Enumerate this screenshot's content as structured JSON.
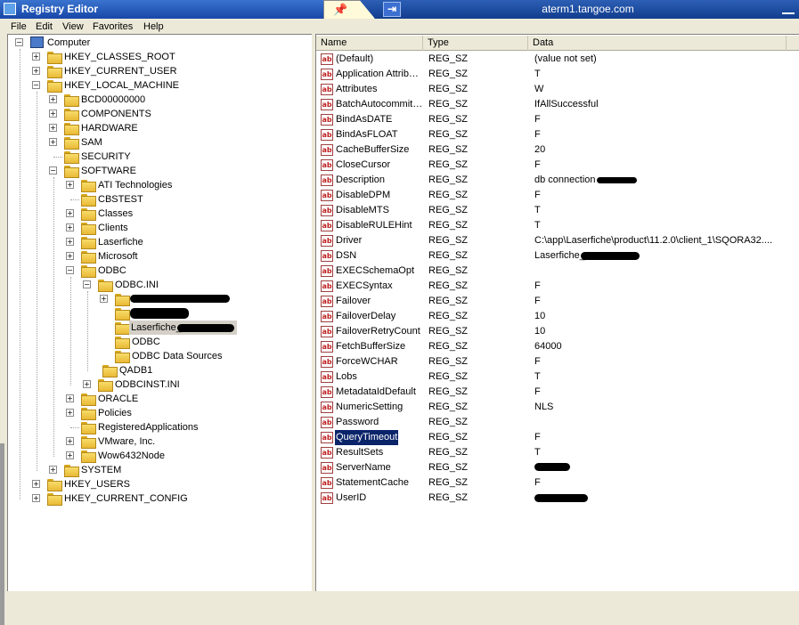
{
  "window": {
    "title": "Registry Editor",
    "remote_host": "aterm1.tangoe.com",
    "pin_glyph": "📌",
    "restore_glyph": "⇥"
  },
  "menu": [
    "File",
    "Edit",
    "View",
    "Favorites",
    "Help"
  ],
  "tree": {
    "computer": "Computer",
    "hkcr": "HKEY_CLASSES_ROOT",
    "hkcu": "HKEY_CURRENT_USER",
    "hklm": "HKEY_LOCAL_MACHINE",
    "bcd": "BCD00000000",
    "components": "COMPONENTS",
    "hardware": "HARDWARE",
    "sam": "SAM",
    "security": "SECURITY",
    "software": "SOFTWARE",
    "ati": "ATI Technologies",
    "cbstest": "CBSTEST",
    "classes": "Classes",
    "clients": "Clients",
    "laserfiche": "Laserfiche",
    "microsoft": "Microsoft",
    "odbc": "ODBC",
    "odbcini": "ODBC.INI",
    "laserfiche_dsn": "Laserfiche_",
    "odbc_sub": "ODBC",
    "odbc_data_sources": "ODBC Data Sources",
    "qadb1": "QADB1",
    "odbcinst": "ODBCINST.INI",
    "oracle": "ORACLE",
    "policies": "Policies",
    "registered_apps": "RegisteredApplications",
    "vmware": "VMware, Inc.",
    "wow6432": "Wow6432Node",
    "system": "SYSTEM",
    "hku": "HKEY_USERS",
    "hkcc": "HKEY_CURRENT_CONFIG"
  },
  "list": {
    "columns": {
      "name": "Name",
      "type": "Type",
      "data": "Data"
    },
    "icon_text": "ab",
    "rows": [
      {
        "name": "(Default)",
        "type": "REG_SZ",
        "data": "(value not set)"
      },
      {
        "name": "Application Attrib…",
        "type": "REG_SZ",
        "data": "T"
      },
      {
        "name": "Attributes",
        "type": "REG_SZ",
        "data": "W"
      },
      {
        "name": "BatchAutocommit…",
        "type": "REG_SZ",
        "data": "IfAllSuccessful"
      },
      {
        "name": "BindAsDATE",
        "type": "REG_SZ",
        "data": "F"
      },
      {
        "name": "BindAsFLOAT",
        "type": "REG_SZ",
        "data": "F"
      },
      {
        "name": "CacheBufferSize",
        "type": "REG_SZ",
        "data": "20"
      },
      {
        "name": "CloseCursor",
        "type": "REG_SZ",
        "data": "F"
      },
      {
        "name": "Description",
        "type": "REG_SZ",
        "data": "db connection"
      },
      {
        "name": "DisableDPM",
        "type": "REG_SZ",
        "data": "F"
      },
      {
        "name": "DisableMTS",
        "type": "REG_SZ",
        "data": "T"
      },
      {
        "name": "DisableRULEHint",
        "type": "REG_SZ",
        "data": "T"
      },
      {
        "name": "Driver",
        "type": "REG_SZ",
        "data": "C:\\app\\Laserfiche\\product\\11.2.0\\client_1\\SQORA32...."
      },
      {
        "name": "DSN",
        "type": "REG_SZ",
        "data": "Laserfiche_"
      },
      {
        "name": "EXECSchemaOpt",
        "type": "REG_SZ",
        "data": ""
      },
      {
        "name": "EXECSyntax",
        "type": "REG_SZ",
        "data": "F"
      },
      {
        "name": "Failover",
        "type": "REG_SZ",
        "data": "F"
      },
      {
        "name": "FailoverDelay",
        "type": "REG_SZ",
        "data": "10"
      },
      {
        "name": "FailoverRetryCount",
        "type": "REG_SZ",
        "data": "10"
      },
      {
        "name": "FetchBufferSize",
        "type": "REG_SZ",
        "data": "64000"
      },
      {
        "name": "ForceWCHAR",
        "type": "REG_SZ",
        "data": "F"
      },
      {
        "name": "Lobs",
        "type": "REG_SZ",
        "data": "T"
      },
      {
        "name": "MetadataIdDefault",
        "type": "REG_SZ",
        "data": "F"
      },
      {
        "name": "NumericSetting",
        "type": "REG_SZ",
        "data": "NLS"
      },
      {
        "name": "Password",
        "type": "REG_SZ",
        "data": ""
      },
      {
        "name": "QueryTimeout",
        "type": "REG_SZ",
        "data": "F",
        "selected": true
      },
      {
        "name": "ResultSets",
        "type": "REG_SZ",
        "data": "T"
      },
      {
        "name": "ServerName",
        "type": "REG_SZ",
        "data": ""
      },
      {
        "name": "StatementCache",
        "type": "REG_SZ",
        "data": "F"
      },
      {
        "name": "UserID",
        "type": "REG_SZ",
        "data": ""
      }
    ]
  }
}
